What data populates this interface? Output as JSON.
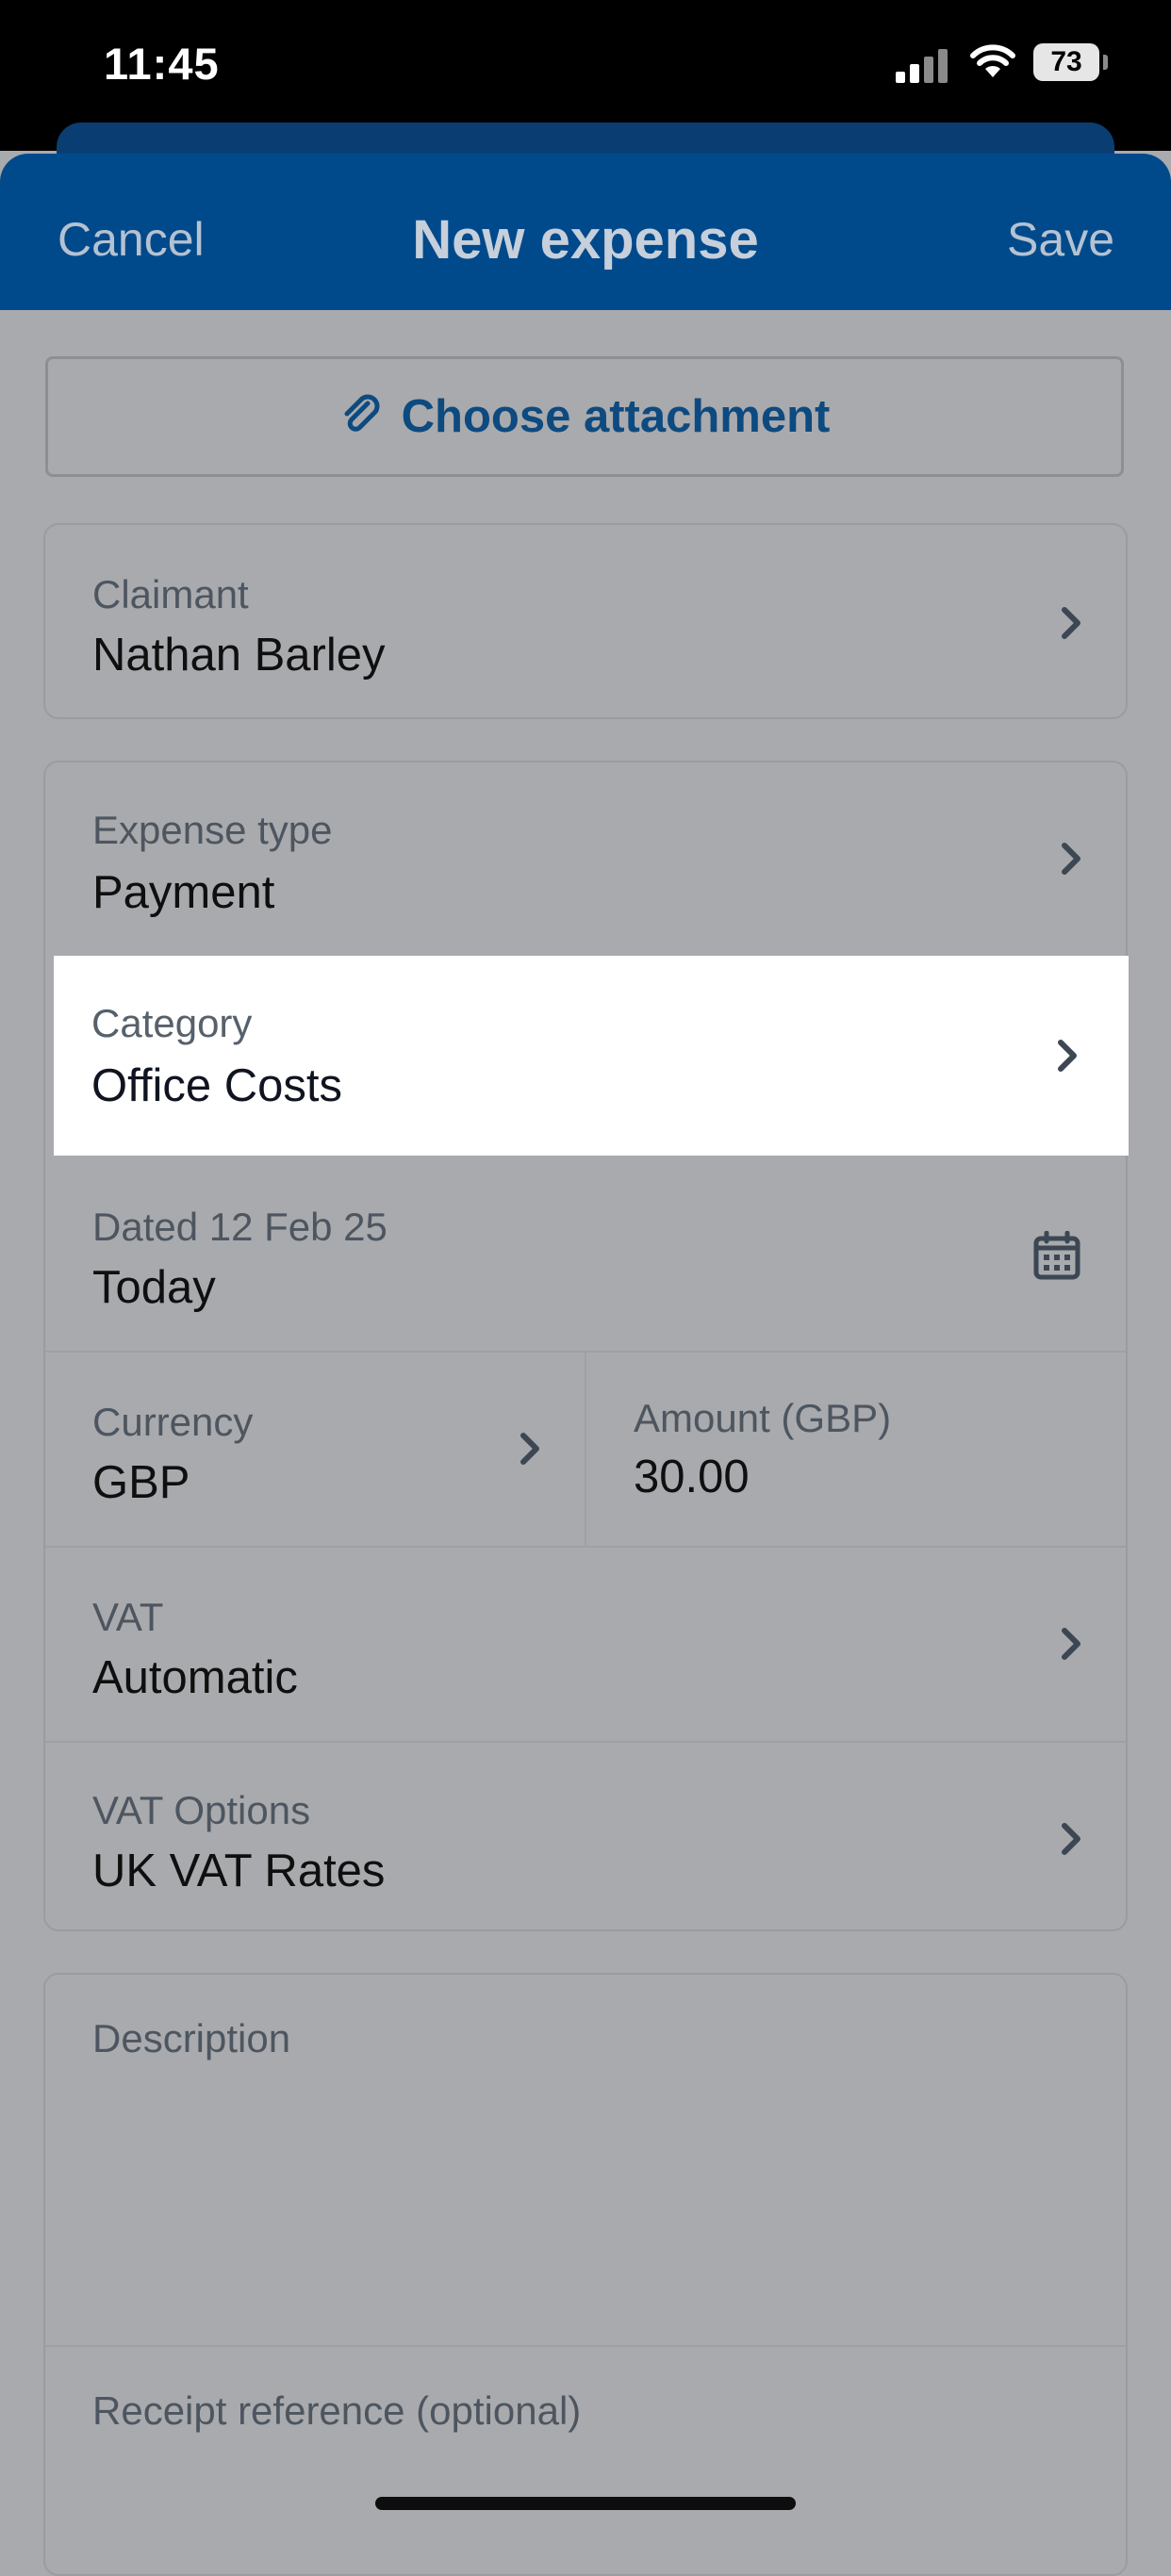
{
  "status_bar": {
    "time": "11:45",
    "battery": "73"
  },
  "nav": {
    "cancel": "Cancel",
    "title": "New expense",
    "save": "Save"
  },
  "attachment": {
    "label": "Choose attachment"
  },
  "claimant": {
    "label": "Claimant",
    "value": "Nathan Barley"
  },
  "expense_type": {
    "label": "Expense type",
    "value": "Payment"
  },
  "category": {
    "label": "Category",
    "value": "Office Costs"
  },
  "date": {
    "label": "Dated 12 Feb 25",
    "value": "Today"
  },
  "currency": {
    "label": "Currency",
    "value": "GBP"
  },
  "amount": {
    "label": "Amount (GBP)",
    "value": "30.00"
  },
  "vat": {
    "label": "VAT",
    "value": "Automatic"
  },
  "vat_options": {
    "label": "VAT Options",
    "value": "UK VAT Rates"
  },
  "description": {
    "label": "Description"
  },
  "receipt": {
    "label": "Receipt reference (optional)"
  },
  "colors": {
    "nav_bar": "#004a8c",
    "accent_text": "#0d4a80",
    "dim_overlay": "#a9aaad",
    "highlight": "#ffffff"
  }
}
